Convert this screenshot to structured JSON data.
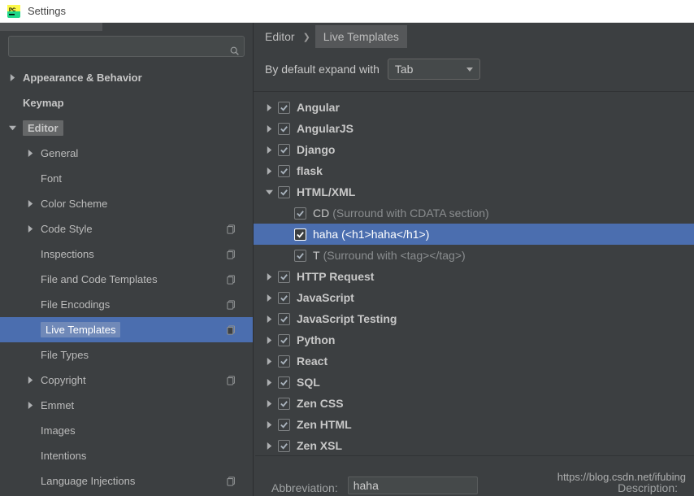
{
  "window": {
    "title": "Settings"
  },
  "sidebar": {
    "search_placeholder": "",
    "items": [
      {
        "label": "Appearance & Behavior",
        "level": 1,
        "arrow": "right",
        "highlight": false,
        "copy": false
      },
      {
        "label": "Keymap",
        "level": 1,
        "arrow": "none",
        "highlight": false,
        "copy": false
      },
      {
        "label": "Editor",
        "level": 1,
        "arrow": "down",
        "highlight": true,
        "copy": false
      },
      {
        "label": "General",
        "level": 2,
        "arrow": "right",
        "highlight": false,
        "copy": false
      },
      {
        "label": "Font",
        "level": 2,
        "arrow": "none",
        "highlight": false,
        "copy": false
      },
      {
        "label": "Color Scheme",
        "level": 2,
        "arrow": "right",
        "highlight": false,
        "copy": false
      },
      {
        "label": "Code Style",
        "level": 2,
        "arrow": "right",
        "highlight": false,
        "copy": true
      },
      {
        "label": "Inspections",
        "level": 2,
        "arrow": "none",
        "highlight": false,
        "copy": true
      },
      {
        "label": "File and Code Templates",
        "level": 2,
        "arrow": "none",
        "highlight": false,
        "copy": true
      },
      {
        "label": "File Encodings",
        "level": 2,
        "arrow": "none",
        "highlight": false,
        "copy": true
      },
      {
        "label": "Live Templates",
        "level": 2,
        "arrow": "none",
        "highlight": true,
        "copy": true,
        "selected": true
      },
      {
        "label": "File Types",
        "level": 2,
        "arrow": "none",
        "highlight": false,
        "copy": false
      },
      {
        "label": "Copyright",
        "level": 2,
        "arrow": "right",
        "highlight": false,
        "copy": true
      },
      {
        "label": "Emmet",
        "level": 2,
        "arrow": "right",
        "highlight": false,
        "copy": false
      },
      {
        "label": "Images",
        "level": 2,
        "arrow": "none",
        "highlight": false,
        "copy": false
      },
      {
        "label": "Intentions",
        "level": 2,
        "arrow": "none",
        "highlight": false,
        "copy": false
      },
      {
        "label": "Language Injections",
        "level": 2,
        "arrow": "none",
        "highlight": false,
        "copy": true
      }
    ]
  },
  "breadcrumb": {
    "root": "Editor",
    "leaf": "Live Templates"
  },
  "expand": {
    "label": "By default expand with",
    "value": "Tab"
  },
  "templates": [
    {
      "type": "group",
      "arrow": "right",
      "checked": true,
      "label": "Angular"
    },
    {
      "type": "group",
      "arrow": "right",
      "checked": true,
      "label": "AngularJS"
    },
    {
      "type": "group",
      "arrow": "right",
      "checked": true,
      "label": "Django"
    },
    {
      "type": "group",
      "arrow": "right",
      "checked": true,
      "label": "flask"
    },
    {
      "type": "group",
      "arrow": "down",
      "checked": true,
      "label": "HTML/XML"
    },
    {
      "type": "child",
      "checked": true,
      "label": "CD",
      "desc": "(Surround with CDATA section)"
    },
    {
      "type": "child",
      "checked": true,
      "label": "haha",
      "desc": "(<h1>haha</h1>)",
      "selected": true
    },
    {
      "type": "child",
      "checked": true,
      "label": "T",
      "desc": "(Surround with <tag></tag>)"
    },
    {
      "type": "group",
      "arrow": "right",
      "checked": true,
      "label": "HTTP Request"
    },
    {
      "type": "group",
      "arrow": "right",
      "checked": true,
      "label": "JavaScript"
    },
    {
      "type": "group",
      "arrow": "right",
      "checked": true,
      "label": "JavaScript Testing"
    },
    {
      "type": "group",
      "arrow": "right",
      "checked": true,
      "label": "Python"
    },
    {
      "type": "group",
      "arrow": "right",
      "checked": true,
      "label": "React"
    },
    {
      "type": "group",
      "arrow": "right",
      "checked": true,
      "label": "SQL"
    },
    {
      "type": "group",
      "arrow": "right",
      "checked": true,
      "label": "Zen CSS"
    },
    {
      "type": "group",
      "arrow": "right",
      "checked": true,
      "label": "Zen HTML"
    },
    {
      "type": "group",
      "arrow": "right",
      "checked": true,
      "label": "Zen XSL"
    }
  ],
  "footer": {
    "abbr_label": "Abbreviation:",
    "abbr_value": "haha",
    "desc_label": "Description:"
  },
  "watermark": "https://blog.csdn.net/ifubing"
}
